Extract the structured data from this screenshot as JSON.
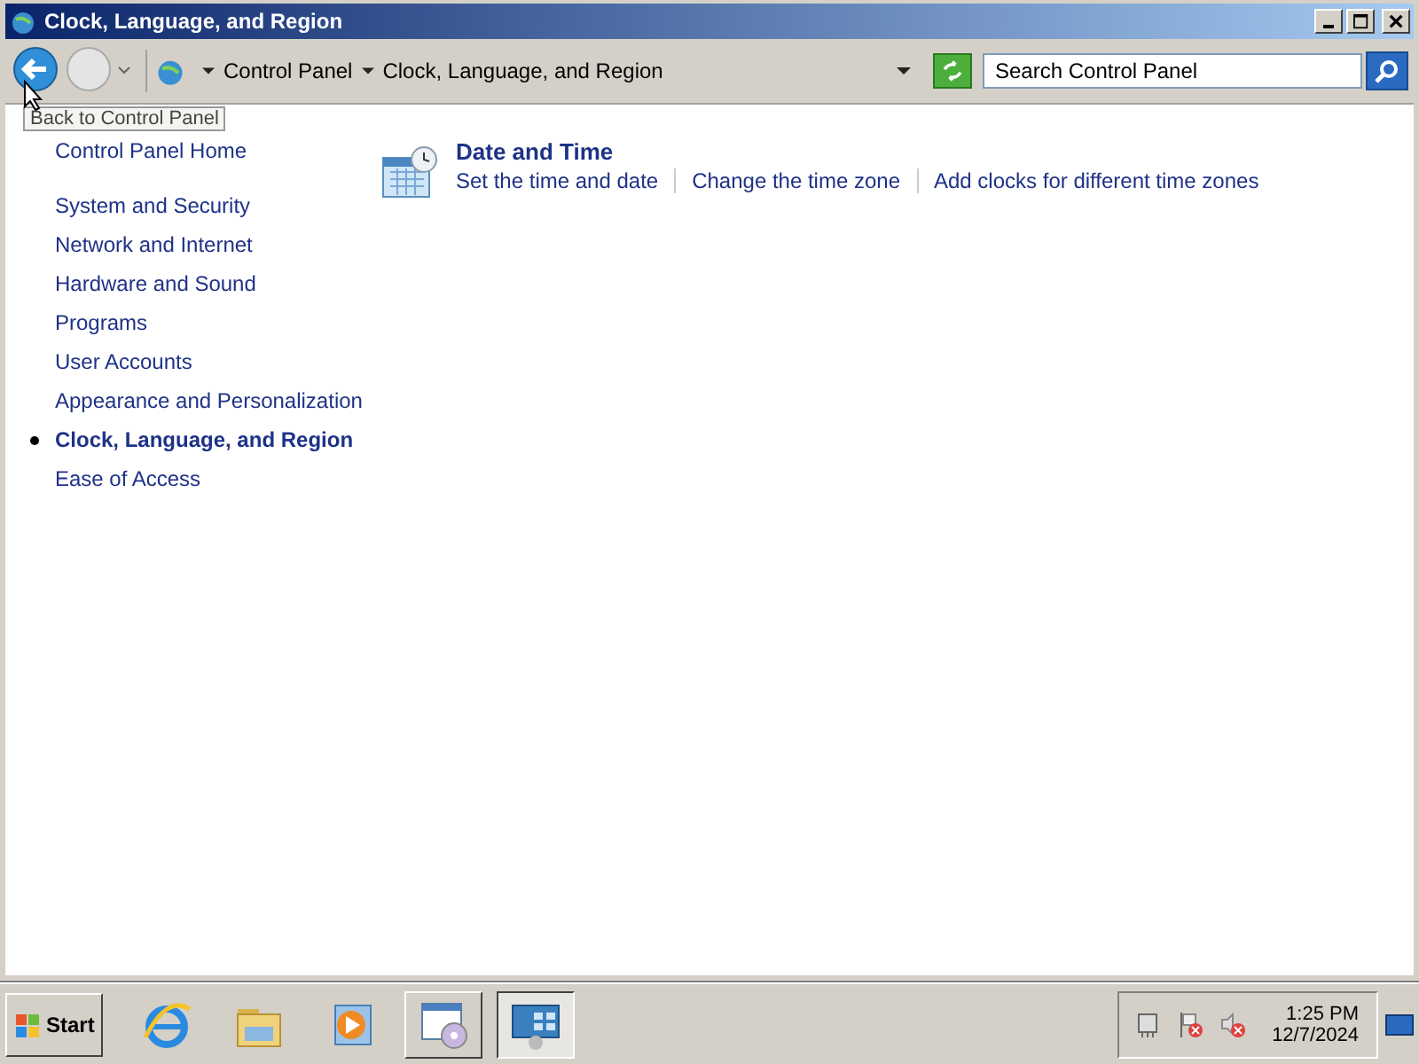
{
  "window": {
    "title": "Clock, Language, and Region"
  },
  "address_bar": {
    "breadcrumbs": [
      "Control Panel",
      "Clock, Language, and Region"
    ]
  },
  "search": {
    "placeholder": "Search Control Panel"
  },
  "tooltip": "Back to Control Panel",
  "sidebar": {
    "home": "Control Panel Home",
    "items": [
      {
        "label": "System and Security",
        "selected": false
      },
      {
        "label": "Network and Internet",
        "selected": false
      },
      {
        "label": "Hardware and Sound",
        "selected": false
      },
      {
        "label": "Programs",
        "selected": false
      },
      {
        "label": "User Accounts",
        "selected": false
      },
      {
        "label": "Appearance and Personalization",
        "selected": false
      },
      {
        "label": "Clock, Language, and Region",
        "selected": true
      },
      {
        "label": "Ease of Access",
        "selected": false
      }
    ]
  },
  "sections": [
    {
      "title": "Date and Time",
      "links": [
        "Set the time and date",
        "Change the time zone",
        "Add clocks for different time zones"
      ]
    }
  ],
  "taskbar": {
    "start": "Start",
    "buttons": [
      {
        "kind": "browser",
        "selected": false
      },
      {
        "kind": "folder",
        "selected": false
      },
      {
        "kind": "media",
        "selected": false
      },
      {
        "kind": "window",
        "selected": false
      },
      {
        "kind": "control",
        "selected": true
      }
    ],
    "time": "1:25 PM",
    "date": "12/7/2024"
  }
}
